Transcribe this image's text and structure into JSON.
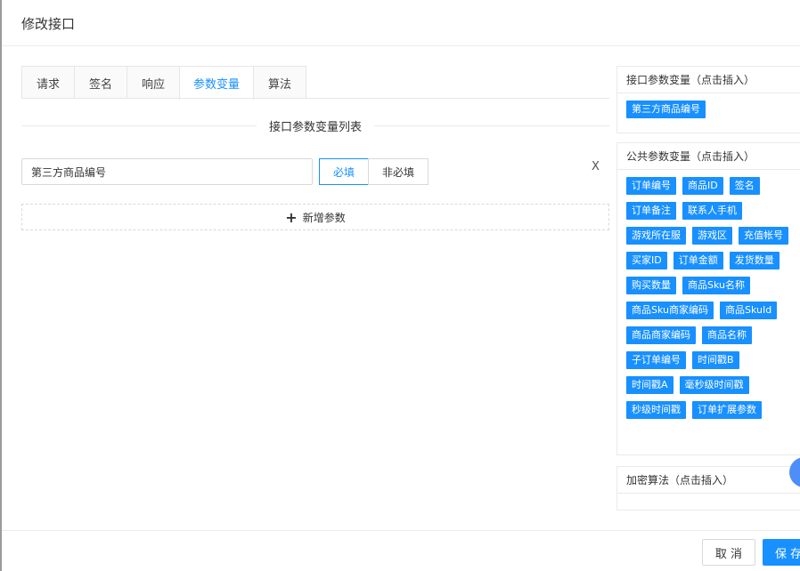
{
  "dialog": {
    "title": "修改接口"
  },
  "tabs": [
    {
      "label": "请求"
    },
    {
      "label": "签名"
    },
    {
      "label": "响应"
    },
    {
      "label": "参数变量",
      "active": true
    },
    {
      "label": "算法"
    }
  ],
  "param_list": {
    "title": "接口参数变量列表",
    "rows": [
      {
        "value": "第三方商品编号",
        "required_label": "必填",
        "optional_label": "非必填",
        "required": true,
        "remove_label": "X"
      }
    ],
    "add_label": "新增参数"
  },
  "interface_vars": {
    "title": "接口参数变量（点击插入）",
    "tags": [
      "第三方商品编号"
    ]
  },
  "public_vars": {
    "title": "公共参数变量（点击插入）",
    "tags": [
      "订单编号",
      "商品ID",
      "签名",
      "订单备注",
      "联系人手机",
      "游戏所在服",
      "游戏区",
      "充值帐号",
      "买家ID",
      "订单金额",
      "发货数量",
      "购买数量",
      "商品Sku名称",
      "商品Sku商家编码",
      "商品SkuId",
      "商品商家编码",
      "商品名称",
      "子订单编号",
      "时间戳B",
      "时间戳A",
      "毫秒级时间戳",
      "秒级时间戳",
      "订单扩展参数"
    ]
  },
  "algorithms": {
    "title": "加密算法（点击插入）"
  },
  "footer": {
    "cancel_label": "取 消",
    "save_label": "保 存"
  },
  "colors": {
    "primary": "#1890ff",
    "border": "#d9d9d9"
  }
}
